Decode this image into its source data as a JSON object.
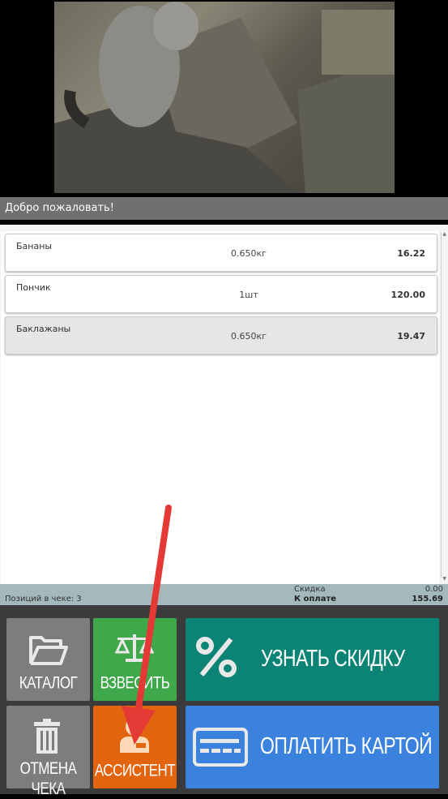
{
  "header": {
    "welcome_text": "Добро пожаловать!"
  },
  "receipt": {
    "items": [
      {
        "name": "Бананы",
        "qty": "0.650кг",
        "price": "16.22"
      },
      {
        "name": "Пончик",
        "qty": "1шт",
        "price": "120.00"
      },
      {
        "name": "Баклажаны",
        "qty": "0.650кг",
        "price": "19.47"
      }
    ],
    "selected_index": 2
  },
  "totals": {
    "positions_label": "Позиций в чеке: 3",
    "discount_label": "Скидка",
    "discount_value": "0.00",
    "to_pay_label": "К оплате",
    "to_pay_value": "155.69"
  },
  "buttons": {
    "catalog": "КАТАЛОГ",
    "weigh": "ВЗВЕСИТЬ",
    "cancel": "ОТМЕНА ЧЕКА",
    "assistant": "АССИСТЕНТ",
    "discount": "УЗНАТЬ СКИДКУ",
    "pay_card": "ОПЛАТИТЬ КАРТОЙ"
  },
  "icons": [
    "folder-icon",
    "scales-icon",
    "trash-icon",
    "person-icon",
    "percent-icon",
    "credit-card-icon",
    "arrow-annotation"
  ],
  "colors": {
    "grey": "#7d7d7d",
    "green": "#3fa84a",
    "orange": "#e2640e",
    "teal": "#0c8475",
    "blue": "#3a82de",
    "arrow": "#e53935"
  }
}
